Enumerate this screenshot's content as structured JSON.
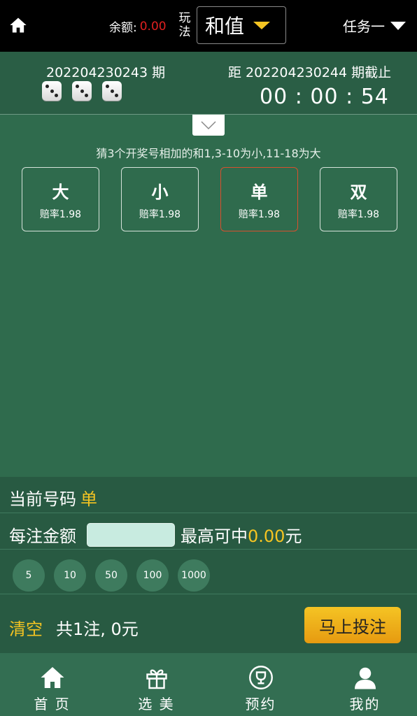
{
  "topbar": {
    "balance_label": "余额:",
    "balance_value": "0.00",
    "play_label": "玩法",
    "play_value": "和值",
    "task_label": "任务一"
  },
  "period": {
    "current": "202204230243 期",
    "next": "距 202204230244 期截止",
    "countdown": "00 : 00 : 54",
    "dice": [
      3,
      3,
      3
    ]
  },
  "hint": "猜3个开奖号相加的和1,3-10为小,11-18为大",
  "options": [
    {
      "name": "大",
      "rate": "赔率1.98",
      "selected": false
    },
    {
      "name": "小",
      "rate": "赔率1.98",
      "selected": false
    },
    {
      "name": "单",
      "rate": "赔率1.98",
      "selected": true
    },
    {
      "name": "双",
      "rate": "赔率1.98",
      "selected": false
    }
  ],
  "panel": {
    "current_label": "当前号码",
    "current_value": "单",
    "amount_label": "每注金额",
    "amount_value": "",
    "max_label_pre": "最高可中",
    "max_value": "0.00",
    "max_label_post": "元",
    "chips": [
      "5",
      "10",
      "50",
      "100",
      "1000"
    ],
    "clear_label": "清空",
    "summary": "共1注, 0元",
    "bet_button": "马上投注"
  },
  "nav": [
    {
      "label": "首 页",
      "icon": "home-icon"
    },
    {
      "label": "选 美",
      "icon": "gift-icon"
    },
    {
      "label": "预约",
      "icon": "trophy-icon"
    },
    {
      "label": "我的",
      "icon": "user-icon"
    }
  ],
  "colors": {
    "accent": "#f5c422",
    "balance": "#e02020",
    "selected_border": "#d8502e",
    "background": "#2f6b4d"
  }
}
